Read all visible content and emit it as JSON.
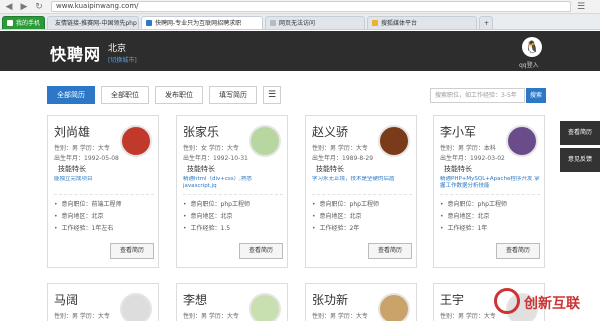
{
  "browser": {
    "url": "www.kuaipinwang.com/",
    "tabs": [
      {
        "label": "我的手机",
        "color": "#2b9a3a"
      },
      {
        "label": "友情链接-推赛网-中国领先php",
        "color": "#e8e8e8"
      },
      {
        "label": "快聘网-专业只为互联网招聘求职",
        "color": "#2c77c6"
      },
      {
        "label": "网页无法访问",
        "color": "#e8e8e8"
      },
      {
        "label": "搜狐媒体平台",
        "color": "#f0b030"
      }
    ]
  },
  "header": {
    "logo": "快聘网",
    "city": "北京",
    "switch_city": "[切换城市]",
    "qq_login": "qq登入"
  },
  "filters": {
    "tabs": [
      "全部简历",
      "全部职位",
      "发布职位",
      "填写简历"
    ],
    "search_placeholder": "搜索职位，如工作经验：3-5年",
    "search_button": "搜索"
  },
  "side": {
    "view_resume": "查看简历",
    "feedback": "意见反馈"
  },
  "labels": {
    "skill_title": "技能特长",
    "view_button": "查看简历"
  },
  "cards": [
    {
      "name": "刘尚雄",
      "info": "性别：男  学历：大专",
      "birth": "出生年月：1992-05-08",
      "skill": "能独立完成项目",
      "position": "意向职位：前端工程师",
      "area": "意向地区：北京",
      "experience": "工作经验：1年左右",
      "avatar_color": "#c0392b"
    },
    {
      "name": "张家乐",
      "info": "性别：女  学历：大专",
      "birth": "出生年月：1992-10-31",
      "skill": "精通html（div+css）,熟悉javascript,jq",
      "position": "意向职位：php工程师",
      "area": "意向地区：北京",
      "experience": "工作经验：1.5",
      "avatar_color": "#b7d6a0"
    },
    {
      "name": "赵义骄",
      "info": "性别：男  学历：大专",
      "birth": "出生年月：1989-8-29",
      "skill": "学习永无止境，技术是坚硬的后盾",
      "position": "意向职位：php工程师",
      "area": "意向地区：北京",
      "experience": "工作经验：2年",
      "avatar_color": "#7a3b1a"
    },
    {
      "name": "李小军",
      "info": "性别：男  学历：本科",
      "birth": "出生年月：1992-03-02",
      "skill": "精通PHP+MySQL+Apache程序开发 掌握工作数据分析技能",
      "position": "意向职位：php工程师",
      "area": "意向地区：北京",
      "experience": "工作经验：1年",
      "avatar_color": "#6b4c8a"
    }
  ],
  "cards_row2": [
    {
      "name": "马阔",
      "info": "性别：男  学历：大专",
      "avatar_color": "#dddddd"
    },
    {
      "name": "李想",
      "info": "性别：男  学历：大专",
      "avatar_color": "#c8e0b0"
    },
    {
      "name": "张功新",
      "info": "性别：男  学历：大专",
      "avatar_color": "#c9a36a"
    },
    {
      "name": "王宇",
      "info": "性别：男  学历：大专",
      "avatar_color": "#e0e0e0"
    }
  ],
  "watermark": "创新互联"
}
